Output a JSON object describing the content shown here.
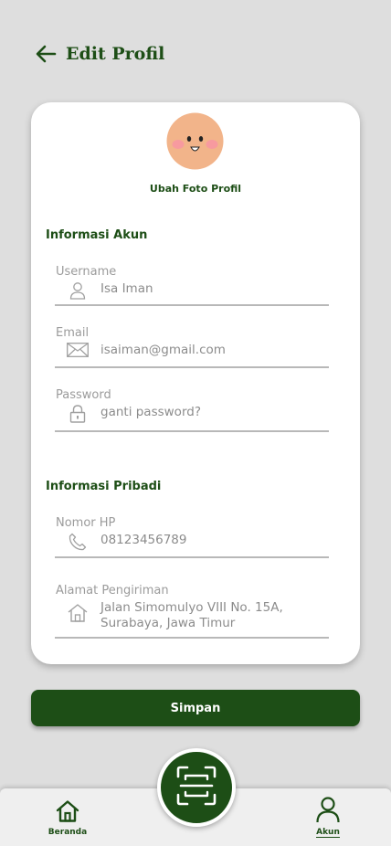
{
  "header": {
    "title": "Edit Profil"
  },
  "profile": {
    "change_photo_label": "Ubah Foto Profil"
  },
  "account_section": {
    "title": "Informasi Akun",
    "username": {
      "label": "Username",
      "value": "Isa Iman",
      "icon": "user-icon"
    },
    "email": {
      "label": "Email",
      "value": "isaiman@gmail.com",
      "icon": "envelope-icon"
    },
    "password": {
      "label": "Password",
      "value": "ganti password?",
      "icon": "lock-icon"
    }
  },
  "personal_section": {
    "title": "Informasi Pribadi",
    "phone": {
      "label": "Nomor HP",
      "value": "08123456789",
      "icon": "phone-icon"
    },
    "address": {
      "label": "Alamat Pengiriman",
      "line1": "Jalan Simomulyo VIII No. 15A,",
      "line2": "Surabaya, Jawa Timur",
      "icon": "home-icon"
    }
  },
  "save_button": {
    "label": "Simpan"
  },
  "bottom_nav": {
    "home": {
      "label": "Beranda",
      "icon": "home-icon"
    },
    "scan": {
      "icon": "scan-icon"
    },
    "account": {
      "label": "Akun",
      "icon": "user-icon"
    }
  },
  "colors": {
    "brand": "#1d4e16",
    "background": "#dedede",
    "card": "#ffffff"
  }
}
